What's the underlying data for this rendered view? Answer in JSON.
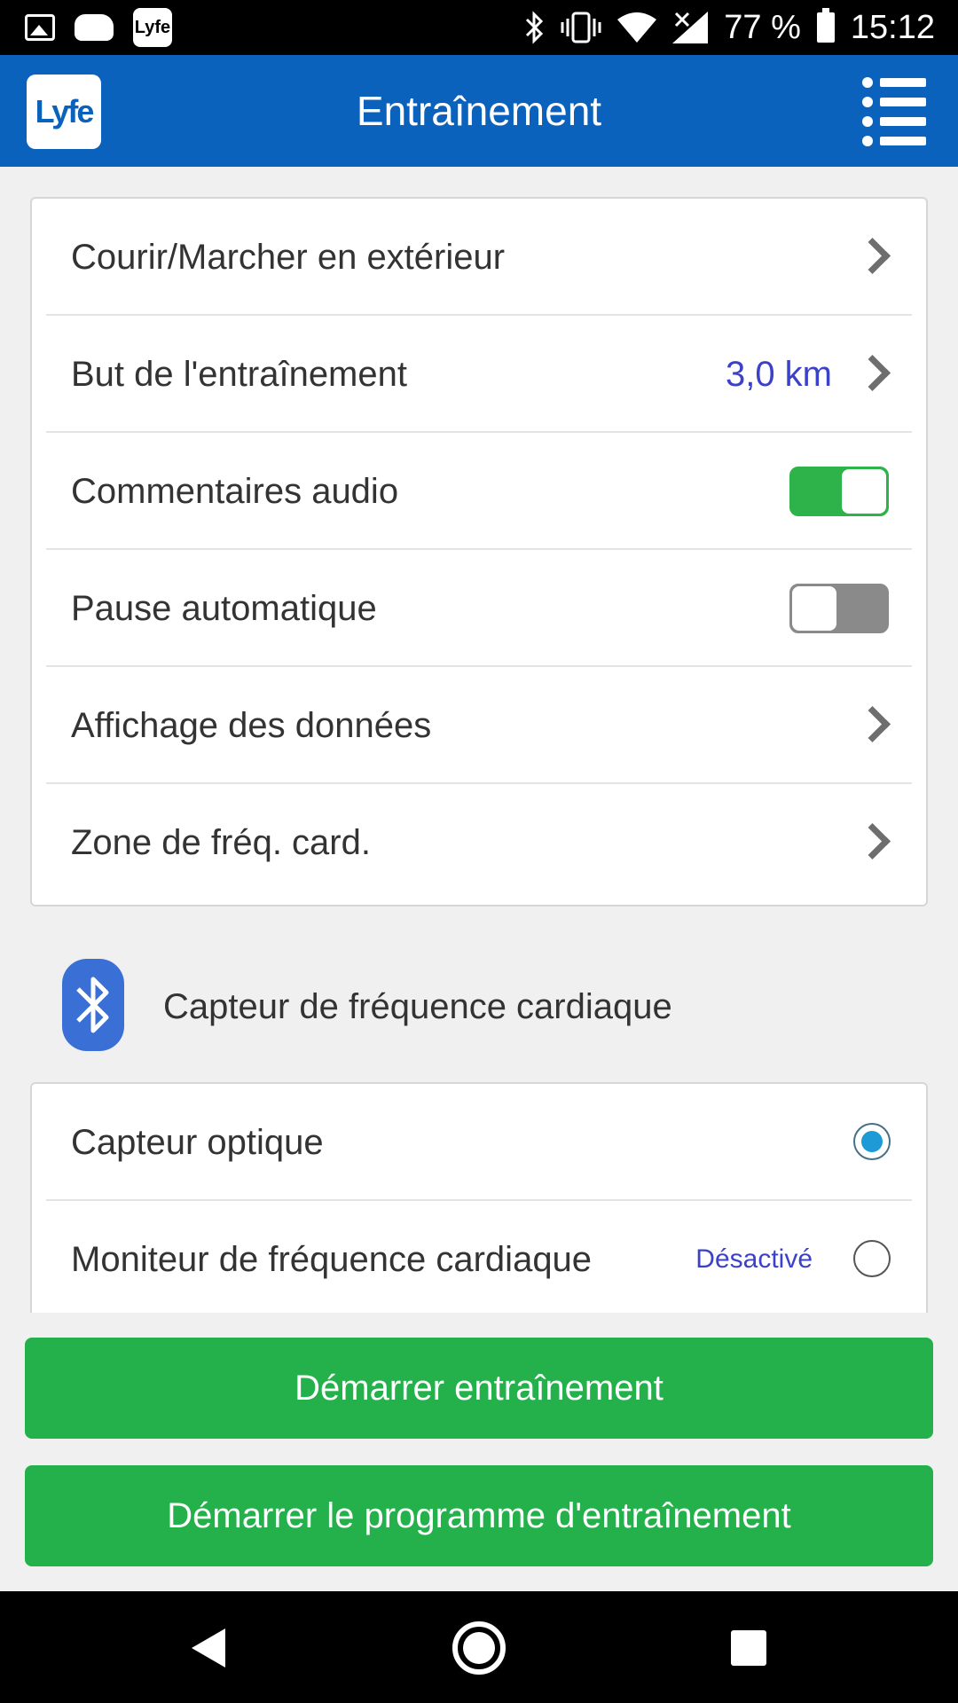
{
  "status_bar": {
    "battery_text": "77 %",
    "time": "15:12",
    "notification_logo_text": "Lyfe"
  },
  "header": {
    "logo_text": "Lyfe",
    "title": "Entraînement",
    "menu_icon": "list-menu-icon"
  },
  "settings": [
    {
      "label": "Courir/Marcher en extérieur",
      "type": "link"
    },
    {
      "label": "But de l'entraînement",
      "type": "link",
      "value": "3,0 km"
    },
    {
      "label": "Commentaires audio",
      "type": "toggle",
      "on": true
    },
    {
      "label": "Pause automatique",
      "type": "toggle",
      "on": false
    },
    {
      "label": "Affichage des données",
      "type": "link"
    },
    {
      "label": "Zone de fréq. card.",
      "type": "link"
    }
  ],
  "hr_section": {
    "title": "Capteur de fréquence cardiaque",
    "icon": "bluetooth-icon",
    "options": [
      {
        "label": "Capteur optique",
        "selected": true
      },
      {
        "label": "Moniteur de fréquence cardiaque",
        "status": "Désactivé",
        "selected": false
      }
    ]
  },
  "buttons": {
    "start_workout": "Démarrer entraînement",
    "start_program": "Démarrer le programme d'entraînement"
  },
  "colors": {
    "header_bg": "#0a62bd",
    "accent_green": "#24b04a",
    "value_blue": "#3c42c8",
    "radio_blue": "#1e9ad6"
  }
}
